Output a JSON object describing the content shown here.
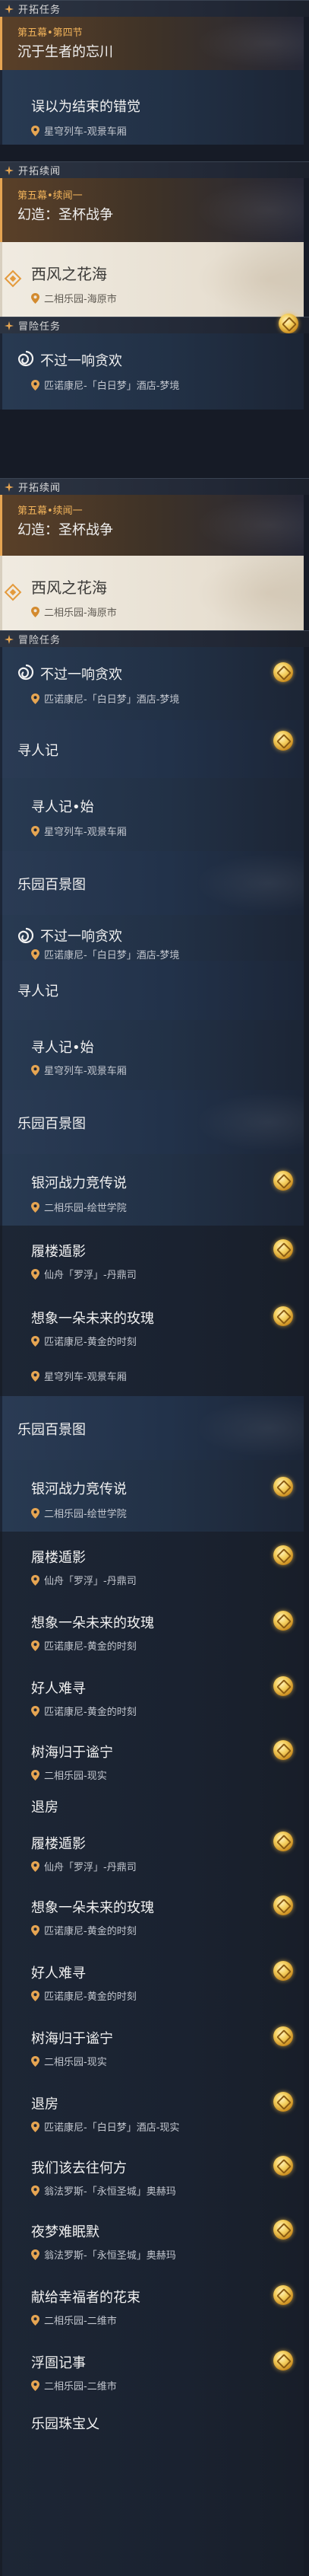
{
  "colors": {
    "accent": "#e6a552",
    "highlight_bg": "#f0ebe1",
    "section_bg": "#2c3442",
    "coin": "#f4cf5e"
  },
  "sections": {
    "trailblaze_mission": "开拓任务",
    "trailblaze_continuance": "开拓续闻",
    "adventure_mission": "冒险任务"
  },
  "items": {
    "act5": {
      "chapter": "第五幕•第四节",
      "title": "沉于生者的忘川"
    },
    "misperception": {
      "title": "误以为结束的错觉",
      "location": "星穹列车-观景车厢"
    },
    "continuance1": {
      "chapter": "第五幕•续闻一",
      "title": "幻造：圣杯战争"
    },
    "west_wind": {
      "title": "西风之花海",
      "location": "二相乐园-海原市"
    },
    "not_fun": {
      "title": "不过一响贪欢",
      "location": "匹诺康尼-「白日梦」酒店-梦境"
    },
    "seeker": {
      "title": "寻人记"
    },
    "seeker_begin": {
      "title": "寻人记•始",
      "location": "星穹列车-观景车厢"
    },
    "paradise": {
      "title": "乐园百景图"
    },
    "galaxy": {
      "title": "银河战力竞传说",
      "location": "二相乐园-绘世学院"
    },
    "building": {
      "title": "履楼遁影",
      "location": "仙舟「罗浮」-丹鼎司"
    },
    "rose": {
      "title": "想象一朵未来的玫瑰",
      "location": "匹诺康尼-黄金的时刻"
    },
    "good_person": {
      "title": "好人难寻",
      "location": "匹诺康尼-黄金的时刻"
    },
    "tree_sea": {
      "title": "树海归于谧宁",
      "location": "二相乐园-现实"
    },
    "checkout": {
      "title": "退房",
      "location": "匹诺康尼-「白日梦」酒店-现实"
    },
    "where_go": {
      "title": "我们该去往何方",
      "location": "翁法罗斯-「永恒圣城」奥赫玛"
    },
    "night_dream": {
      "title": "夜梦难眠默",
      "location": "翁法罗斯-「永恒圣城」奥赫玛"
    },
    "dedicate": {
      "title": "献给幸福者的花束",
      "location": "二相乐园-二维市"
    },
    "floating": {
      "title": "浮圄记事",
      "location": "二相乐园-二维市"
    },
    "partial_tail": {
      "title": "乐园珠宝乂"
    }
  }
}
